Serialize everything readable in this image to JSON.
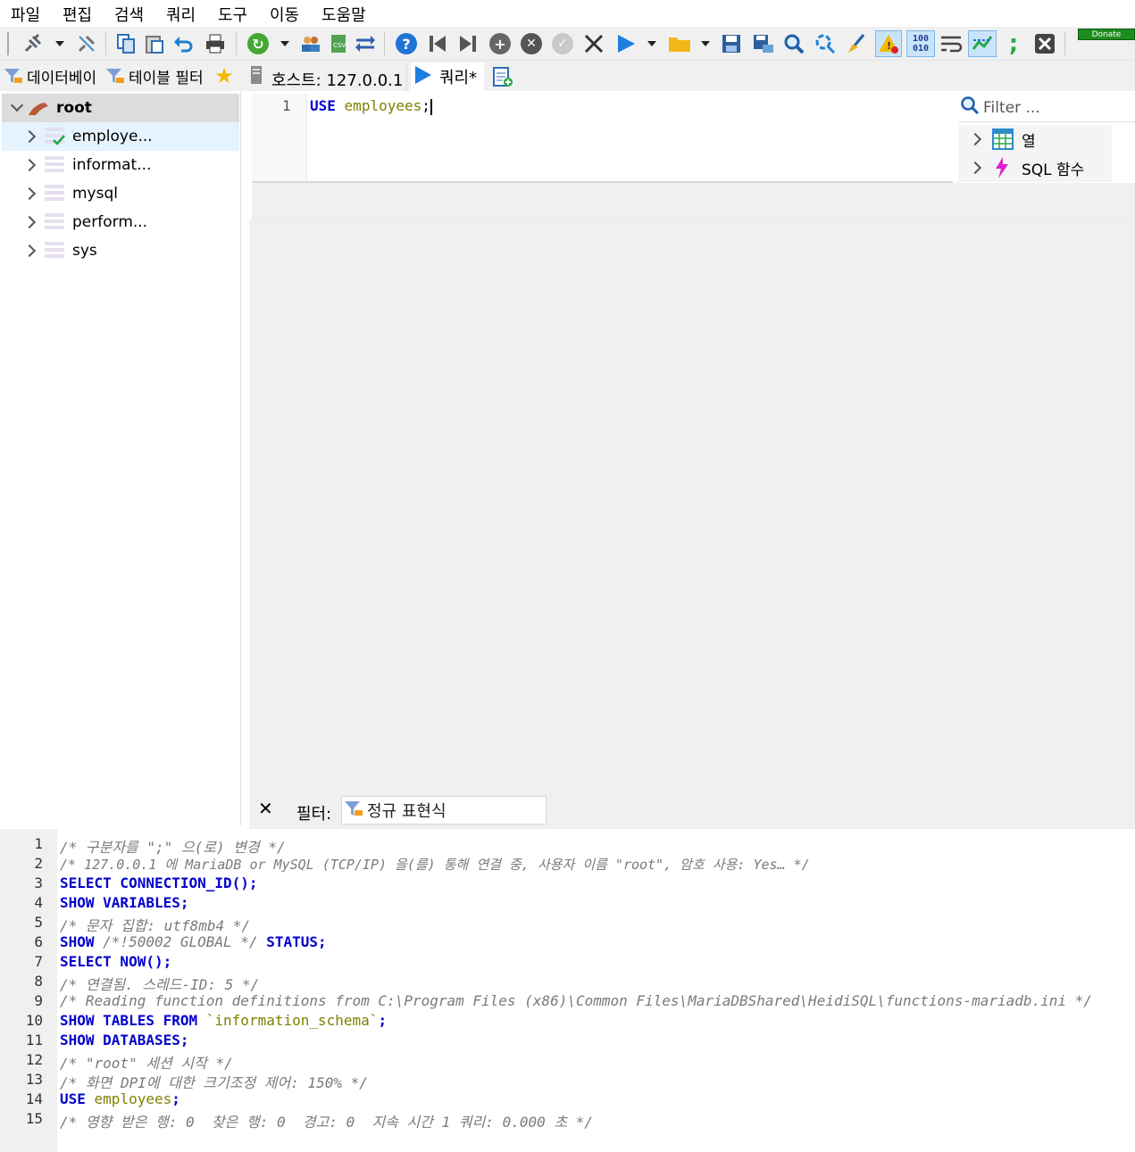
{
  "menu": [
    "파일",
    "편집",
    "검색",
    "쿼리",
    "도구",
    "이동",
    "도움말"
  ],
  "toolbar": {
    "icons": [
      "connect-icon",
      "disconnect-icon",
      "copy-icon",
      "paste-icon",
      "undo-icon",
      "print-icon",
      "refresh-icon",
      "user-manager-icon",
      "export-csv-icon",
      "sync-icon",
      "help-icon",
      "first-icon",
      "last-icon",
      "add-icon",
      "delete-icon",
      "post-icon",
      "cancel-icon",
      "run-icon",
      "open-folder-icon",
      "save-icon",
      "save-as-icon",
      "find-icon",
      "replace-icon",
      "clear-icon",
      "warning-icon",
      "binary-icon",
      "wrap-icon",
      "explain-icon",
      "semicolon-icon",
      "close-icon"
    ],
    "binary_label_top": "100",
    "binary_label_bottom": "010",
    "semicolon_label": ";",
    "donate_label": "Donate"
  },
  "left_tabs": [
    "데이터베이",
    "테이블 필터"
  ],
  "tree": {
    "root": "root",
    "databases": [
      "employe...",
      "informat...",
      "mysql",
      "perform...",
      "sys"
    ]
  },
  "right_tabs": {
    "host": "호스트: 127.0.0.1",
    "query": "쿼리*"
  },
  "editor": {
    "line_numbers": [
      "1"
    ],
    "keyword": "USE",
    "identifier": "employees",
    "terminator": ";"
  },
  "helpers": {
    "filter_placeholder": "Filter ...",
    "items": [
      "열",
      "SQL 함수"
    ]
  },
  "filterbar": {
    "close_label": "✕",
    "label": "필터:",
    "placeholder": "정규 표현식"
  },
  "log": {
    "lines": [
      "1",
      "2",
      "3",
      "4",
      "5",
      "6",
      "7",
      "8",
      "9",
      "10",
      "11",
      "12",
      "13",
      "14",
      "15"
    ],
    "l1": "/* 구분자를 \";\" 으(로) 변경 */",
    "l2": "/* 127.0.0.1 에 MariaDB or MySQL (TCP/IP) 을(를) 통해 연결 중, 사용자 이름 \"root\", 암호 사용: Yes… */",
    "l3a": "SELECT",
    "l3b": " CONNECTION_ID",
    "l3c": "();",
    "l4a": "SHOW",
    "l4b": " VARIABLES",
    "l4c": ";",
    "l5": "/* 문자 집합: utf8mb4 */",
    "l6a": "SHOW",
    "l6b": " /*!50002 GLOBAL */ ",
    "l6c": "STATUS",
    "l6d": ";",
    "l7a": "SELECT",
    "l7b": " NOW",
    "l7c": "();",
    "l8": "/* 연결됨. 스레드-ID: 5 */",
    "l9": "/* Reading function definitions from C:\\Program Files (x86)\\Common Files\\MariaDBShared\\HeidiSQL\\functions-mariadb.ini */",
    "l10a": "SHOW",
    "l10b": " TABLES",
    "l10c": " FROM",
    "l10d": " `information_schema`",
    "l10e": ";",
    "l11a": "SHOW",
    "l11b": " DATABASES",
    "l11c": ";",
    "l12": "/* \"root\" 세션 시작 */",
    "l13": "/* 화면 DPI에 대한 크기조정 제어: 150% */",
    "l14a": "USE",
    "l14b": " employees",
    "l14c": ";",
    "l15": "/* 영향 받은 행: 0  찾은 행: 0  경고: 0  지속 시간 1 쿼리: 0.000 초 */"
  },
  "colors": {
    "keyword": "#0000cc",
    "identifier": "#808000",
    "comment": "#7a7a7a",
    "selection": "#e5f3ff"
  }
}
